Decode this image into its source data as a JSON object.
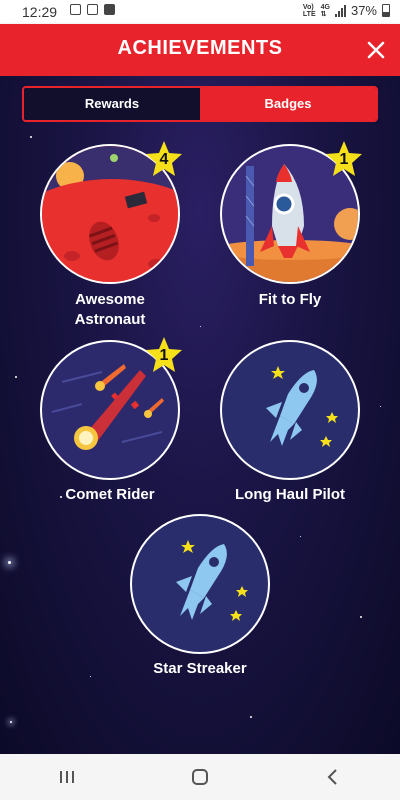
{
  "status_bar": {
    "time": "12:29",
    "network_top": "Vo)",
    "network_bottom": "LTE",
    "net_type": "4G",
    "battery": "37%"
  },
  "header": {
    "title": "ACHIEVEMENTS",
    "close_icon": "close-icon"
  },
  "tabs": [
    {
      "label": "Rewards",
      "active": false
    },
    {
      "label": "Badges",
      "active": true
    }
  ],
  "badges": [
    {
      "name_line1": "Awesome",
      "name_line2": "Astronaut",
      "count": "4",
      "icon": "mars-footprint"
    },
    {
      "name": "Fit to Fly",
      "count": "1",
      "icon": "rocket-launch"
    },
    {
      "name": "Comet Rider",
      "count": "1",
      "icon": "comets"
    },
    {
      "name": "Long Haul Pilot",
      "count": "",
      "icon": "rocket-locked"
    },
    {
      "name": "Star Streaker",
      "count": "",
      "icon": "rocket-locked"
    }
  ],
  "colors": {
    "accent": "#e8232b",
    "count_badge": "#f6e01a",
    "background": "#0c0a28",
    "locked_circle": "#2a2d6b",
    "locked_rocket": "#8ec8f0"
  },
  "nav": [
    "recents-icon",
    "home-icon",
    "back-icon"
  ]
}
